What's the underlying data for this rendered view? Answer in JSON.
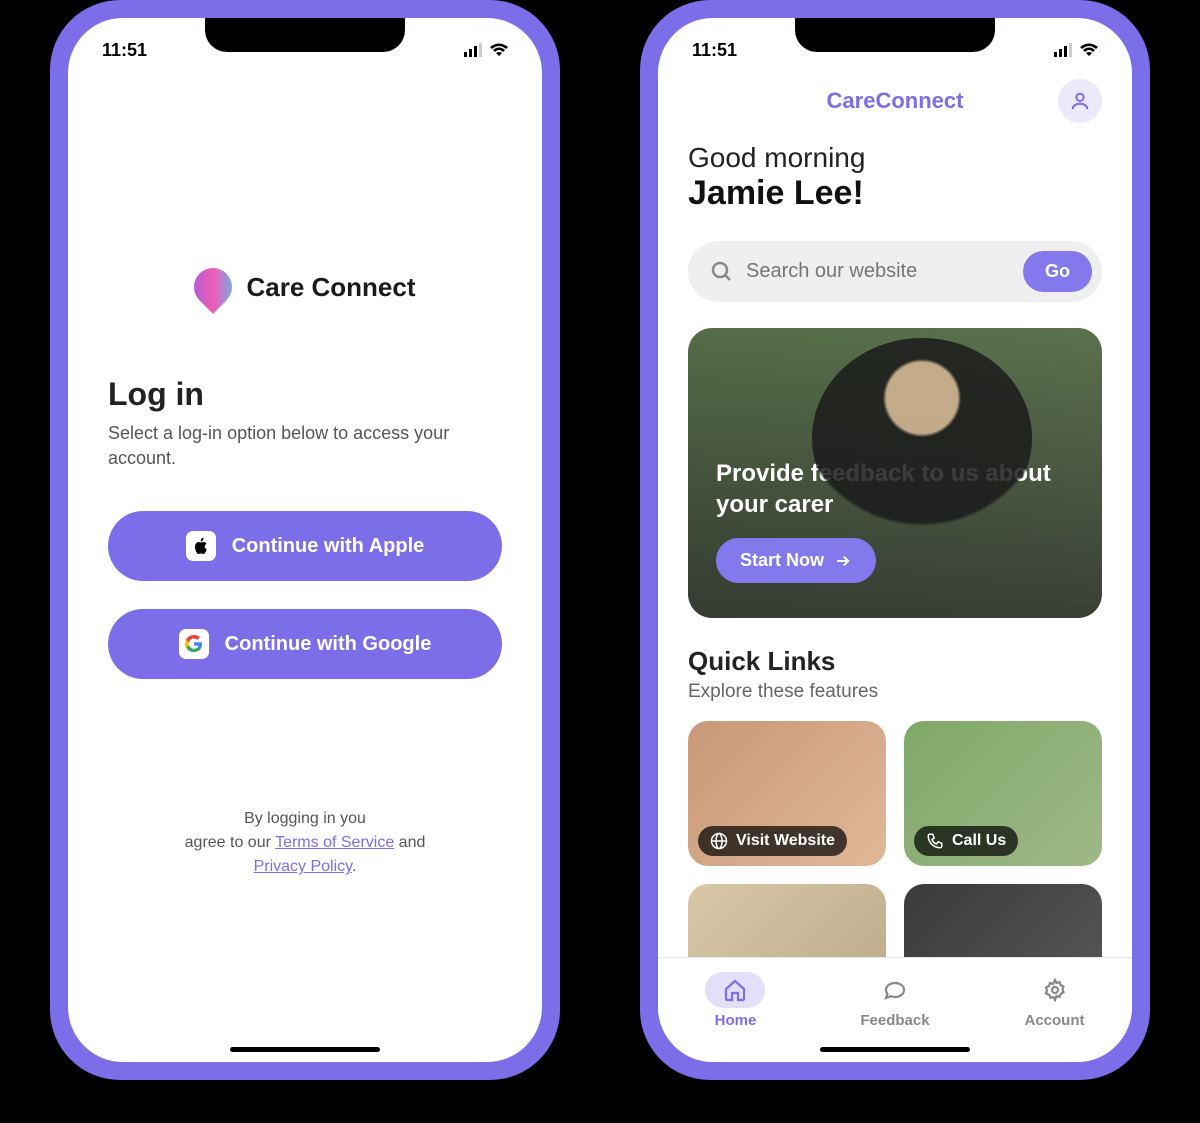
{
  "status": {
    "time": "11:51"
  },
  "login": {
    "logo_text": "Care Connect",
    "heading": "Log in",
    "subheading": "Select a log-in option below to access your account.",
    "apple_label": "Continue with Apple",
    "google_label": "Continue with Google",
    "legal_line1": "By logging in you",
    "legal_prefix": "agree to our ",
    "tos": "Terms of Service",
    "and": " and ",
    "privacy": "Privacy Policy",
    "period": "."
  },
  "home": {
    "app_title": "CareConnect",
    "greeting": "Good morning",
    "user_name": "Jamie Lee!",
    "search_placeholder": "Search our website",
    "go_label": "Go",
    "hero_title": "Provide feedback to us about your carer",
    "start_label": "Start Now",
    "ql_heading": "Quick Links",
    "ql_sub": "Explore these features",
    "ql_items": [
      {
        "label": "Visit Website",
        "icon": "globe"
      },
      {
        "label": "Call Us",
        "icon": "phone"
      }
    ],
    "tabs": [
      {
        "label": "Home",
        "active": true
      },
      {
        "label": "Feedback",
        "active": false
      },
      {
        "label": "Account",
        "active": false
      }
    ]
  },
  "colors": {
    "accent": "#7b6ee8"
  }
}
